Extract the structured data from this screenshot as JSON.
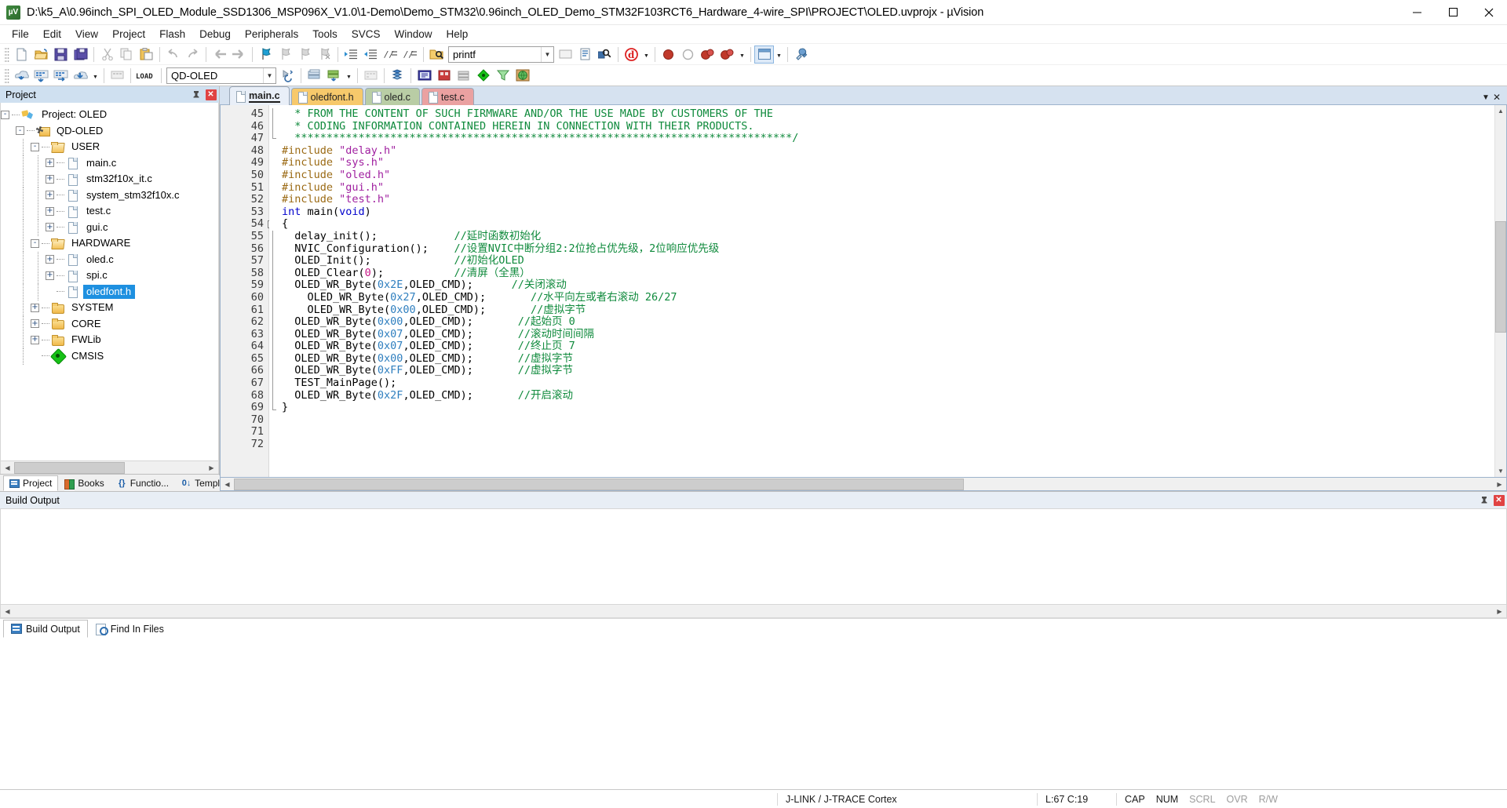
{
  "window": {
    "title": "D:\\k5_A\\0.96inch_SPI_OLED_Module_SSD1306_MSP096X_V1.0\\1-Demo\\Demo_STM32\\0.96inch_OLED_Demo_STM32F103RCT6_Hardware_4-wire_SPI\\PROJECT\\OLED.uvprojx - µVision",
    "logo_text": "µV",
    "minimize": "—",
    "maximize": "❐",
    "close": "✕"
  },
  "menubar": [
    {
      "label": "File"
    },
    {
      "label": "Edit"
    },
    {
      "label": "View"
    },
    {
      "label": "Project"
    },
    {
      "label": "Flash"
    },
    {
      "label": "Debug"
    },
    {
      "label": "Peripherals"
    },
    {
      "label": "Tools"
    },
    {
      "label": "SVCS"
    },
    {
      "label": "Window"
    },
    {
      "label": "Help"
    }
  ],
  "toolbar_main": {
    "buttons": [
      {
        "name": "new-file-icon",
        "glyph": "□"
      },
      {
        "name": "open-file-icon",
        "glyph": "▢"
      },
      {
        "name": "save-icon",
        "glyph": "▣"
      },
      {
        "name": "save-all-icon",
        "glyph": "▤"
      },
      {
        "name": "cut-icon",
        "glyph": "✀"
      },
      {
        "name": "copy-icon",
        "glyph": "⧉"
      },
      {
        "name": "paste-icon",
        "glyph": "▧"
      },
      {
        "name": "undo-icon",
        "glyph": "↶"
      },
      {
        "name": "redo-icon",
        "glyph": "↷"
      },
      {
        "name": "navigate-back-icon",
        "glyph": "←"
      },
      {
        "name": "navigate-forward-icon",
        "glyph": "→"
      },
      {
        "name": "bookmark-toggle-icon",
        "glyph": "⚑"
      },
      {
        "name": "bookmark-prev-icon",
        "glyph": "⚐"
      },
      {
        "name": "bookmark-next-icon",
        "glyph": "⚐"
      },
      {
        "name": "bookmark-clear-icon",
        "glyph": "⚐"
      },
      {
        "name": "indent-icon",
        "glyph": "⇥"
      },
      {
        "name": "outdent-icon",
        "glyph": "⇤"
      },
      {
        "name": "comment-icon",
        "glyph": "//≡"
      },
      {
        "name": "uncomment-icon",
        "glyph": "//≡"
      },
      {
        "name": "find-in-files-icon",
        "glyph": "🔍"
      }
    ],
    "search_value": "printf",
    "right_buttons": [
      {
        "name": "insert-bookmark-icon",
        "glyph": "▭"
      },
      {
        "name": "source-browse-icon",
        "glyph": "▤"
      },
      {
        "name": "find-icon",
        "glyph": "🔍"
      },
      {
        "name": "debug-icon",
        "glyph": "@"
      },
      {
        "name": "breakpoint-icon",
        "glyph": "●"
      },
      {
        "name": "disable-breakpoint-icon",
        "glyph": "○"
      },
      {
        "name": "kill-breakpoints-icon",
        "glyph": "⬣"
      },
      {
        "name": "disable-all-breakpoints-icon",
        "glyph": "⬣"
      },
      {
        "name": "window-layout-icon",
        "glyph": "▥"
      },
      {
        "name": "configure-icon",
        "glyph": "🔧"
      }
    ]
  },
  "toolbar_build": {
    "buttons": [
      {
        "name": "translate-icon",
        "glyph": "⬇"
      },
      {
        "name": "build-icon",
        "glyph": "▦"
      },
      {
        "name": "rebuild-icon",
        "glyph": "▦"
      },
      {
        "name": "batch-build-icon",
        "glyph": "⬇"
      },
      {
        "name": "stop-build-icon",
        "glyph": "▨"
      },
      {
        "name": "download-icon",
        "glyph": "LOAD"
      },
      {
        "name": "target-options-icon",
        "glyph": "✦"
      },
      {
        "name": "manage-project-items-icon",
        "glyph": "▩"
      },
      {
        "name": "packs-icon",
        "glyph": "◆"
      },
      {
        "name": "pack-installer-icon",
        "glyph": "▽"
      },
      {
        "name": "manage-run-time-env-icon",
        "glyph": "▦"
      }
    ],
    "target_value": "QD-OLED"
  },
  "project_panel": {
    "header": "Project",
    "pin_glyph": "📌",
    "close_glyph": "✕",
    "tree": [
      {
        "label": "Project: OLED",
        "depth": 0,
        "icon": "proj",
        "expander": "-",
        "selected": false
      },
      {
        "label": "QD-OLED",
        "depth": 1,
        "icon": "target",
        "expander": "-",
        "selected": false
      },
      {
        "label": "USER",
        "depth": 2,
        "icon": "folder-open",
        "expander": "-",
        "selected": false
      },
      {
        "label": "main.c",
        "depth": 3,
        "icon": "file",
        "expander": "+",
        "selected": false
      },
      {
        "label": "stm32f10x_it.c",
        "depth": 3,
        "icon": "file",
        "expander": "+",
        "selected": false
      },
      {
        "label": "system_stm32f10x.c",
        "depth": 3,
        "icon": "file",
        "expander": "+",
        "selected": false
      },
      {
        "label": "test.c",
        "depth": 3,
        "icon": "file",
        "expander": "+",
        "selected": false
      },
      {
        "label": "gui.c",
        "depth": 3,
        "icon": "file",
        "expander": "+",
        "selected": false
      },
      {
        "label": "HARDWARE",
        "depth": 2,
        "icon": "folder-open",
        "expander": "-",
        "selected": false
      },
      {
        "label": "oled.c",
        "depth": 3,
        "icon": "file",
        "expander": "+",
        "selected": false
      },
      {
        "label": "spi.c",
        "depth": 3,
        "icon": "file",
        "expander": "+",
        "selected": false
      },
      {
        "label": "oledfont.h",
        "depth": 3,
        "icon": "file",
        "expander": "",
        "selected": true
      },
      {
        "label": "SYSTEM",
        "depth": 2,
        "icon": "folder",
        "expander": "+",
        "selected": false
      },
      {
        "label": "CORE",
        "depth": 2,
        "icon": "folder",
        "expander": "+",
        "selected": false
      },
      {
        "label": "FWLib",
        "depth": 2,
        "icon": "folder",
        "expander": "+",
        "selected": false
      },
      {
        "label": "CMSIS",
        "depth": 2,
        "icon": "cmsis",
        "expander": "",
        "selected": false
      }
    ],
    "tabs": [
      {
        "label": "Project",
        "icon": "pi-project",
        "active": true
      },
      {
        "label": "Books",
        "icon": "pi-books",
        "active": false
      },
      {
        "label": "Functio...",
        "icon": "pi-funcs",
        "glyph": "{}",
        "active": false
      },
      {
        "label": "Templa...",
        "icon": "pi-templ",
        "glyph": "0↓",
        "active": false
      }
    ]
  },
  "editor": {
    "tabs": [
      {
        "label": "main.c",
        "style": "active",
        "active": true
      },
      {
        "label": "oledfont.h",
        "style": "t-yellow",
        "active": false
      },
      {
        "label": "oled.c",
        "style": "t-green",
        "active": false
      },
      {
        "label": "test.c",
        "style": "t-red",
        "active": false
      }
    ],
    "collapse_glyph": "▼",
    "close_glyph": "✕",
    "first_line_number": 45,
    "lines": [
      {
        "n": 45,
        "fold": "",
        "segs": [
          {
            "t": "  * FROM THE CONTENT OF SUCH FIRMWARE AND/OR THE USE MADE BY CUSTOMERS OF THE",
            "c": "c-cmt"
          }
        ]
      },
      {
        "n": 46,
        "fold": "",
        "segs": [
          {
            "t": "  * CODING INFORMATION CONTAINED HEREIN IN CONNECTION WITH THEIR PRODUCTS.",
            "c": "c-cmt"
          }
        ]
      },
      {
        "n": 47,
        "fold": "",
        "segs": [
          {
            "t": "  ******************************************************************************/",
            "c": "c-cmt"
          }
        ]
      },
      {
        "n": 48,
        "fold": "",
        "segs": [
          {
            "t": "#include ",
            "c": "c-pre"
          },
          {
            "t": "\"delay.h\"",
            "c": "c-str"
          }
        ]
      },
      {
        "n": 49,
        "fold": "",
        "segs": [
          {
            "t": "#include ",
            "c": "c-pre"
          },
          {
            "t": "\"sys.h\"",
            "c": "c-str"
          }
        ]
      },
      {
        "n": 50,
        "fold": "",
        "segs": [
          {
            "t": "#include ",
            "c": "c-pre"
          },
          {
            "t": "\"oled.h\"",
            "c": "c-str"
          }
        ]
      },
      {
        "n": 51,
        "fold": "",
        "segs": [
          {
            "t": "#include ",
            "c": "c-pre"
          },
          {
            "t": "\"gui.h\"",
            "c": "c-str"
          }
        ]
      },
      {
        "n": 52,
        "fold": "",
        "segs": [
          {
            "t": "#include ",
            "c": "c-pre"
          },
          {
            "t": "\"test.h\"",
            "c": "c-str"
          }
        ]
      },
      {
        "n": 53,
        "fold": "",
        "segs": [
          {
            "t": "int ",
            "c": "c-kw"
          },
          {
            "t": "main(",
            "c": "c-plain"
          },
          {
            "t": "void",
            "c": "c-kw"
          },
          {
            "t": ")",
            "c": "c-plain"
          }
        ]
      },
      {
        "n": 54,
        "fold": "-",
        "segs": [
          {
            "t": "{",
            "c": "c-plain"
          }
        ]
      },
      {
        "n": 55,
        "fold": "",
        "segs": [
          {
            "t": "  delay_init();            ",
            "c": "c-plain"
          },
          {
            "t": "//延时函数初始化",
            "c": "c-cmt"
          }
        ]
      },
      {
        "n": 56,
        "fold": "",
        "segs": [
          {
            "t": "  NVIC_Configuration();    ",
            "c": "c-plain"
          },
          {
            "t": "//设置NVIC中断分组2:2位抢占优先级，2位响应优先级",
            "c": "c-cmt"
          }
        ]
      },
      {
        "n": 57,
        "fold": "",
        "segs": [
          {
            "t": "  OLED_Init();             ",
            "c": "c-plain"
          },
          {
            "t": "//初始化OLED",
            "c": "c-cmt"
          }
        ]
      },
      {
        "n": 58,
        "fold": "",
        "segs": [
          {
            "t": "  OLED_Clear(",
            "c": "c-plain"
          },
          {
            "t": "0",
            "c": "c-num"
          },
          {
            "t": ");           ",
            "c": "c-plain"
          },
          {
            "t": "//清屏（全黑）",
            "c": "c-cmt"
          }
        ]
      },
      {
        "n": 59,
        "fold": "",
        "segs": [
          {
            "t": "  OLED_WR_Byte(",
            "c": "c-plain"
          },
          {
            "t": "0x2E",
            "c": "c-num2"
          },
          {
            "t": ",OLED_CMD);      ",
            "c": "c-plain"
          },
          {
            "t": "//关闭滚动",
            "c": "c-cmt"
          }
        ]
      },
      {
        "n": 60,
        "fold": "",
        "segs": [
          {
            "t": "    OLED_WR_Byte(",
            "c": "c-plain"
          },
          {
            "t": "0x27",
            "c": "c-num2"
          },
          {
            "t": ",OLED_CMD);       ",
            "c": "c-plain"
          },
          {
            "t": "//水平向左或者右滚动 26/27",
            "c": "c-cmt"
          }
        ]
      },
      {
        "n": 61,
        "fold": "",
        "segs": [
          {
            "t": "    OLED_WR_Byte(",
            "c": "c-plain"
          },
          {
            "t": "0x00",
            "c": "c-num2"
          },
          {
            "t": ",OLED_CMD);       ",
            "c": "c-plain"
          },
          {
            "t": "//虚拟字节",
            "c": "c-cmt"
          }
        ]
      },
      {
        "n": 62,
        "fold": "",
        "segs": [
          {
            "t": "  OLED_WR_Byte(",
            "c": "c-plain"
          },
          {
            "t": "0x00",
            "c": "c-num2"
          },
          {
            "t": ",OLED_CMD);       ",
            "c": "c-plain"
          },
          {
            "t": "//起始页 0",
            "c": "c-cmt"
          }
        ]
      },
      {
        "n": 63,
        "fold": "",
        "segs": [
          {
            "t": "  OLED_WR_Byte(",
            "c": "c-plain"
          },
          {
            "t": "0x07",
            "c": "c-num2"
          },
          {
            "t": ",OLED_CMD);       ",
            "c": "c-plain"
          },
          {
            "t": "//滚动时间间隔",
            "c": "c-cmt"
          }
        ]
      },
      {
        "n": 64,
        "fold": "",
        "segs": [
          {
            "t": "  OLED_WR_Byte(",
            "c": "c-plain"
          },
          {
            "t": "0x07",
            "c": "c-num2"
          },
          {
            "t": ",OLED_CMD);       ",
            "c": "c-plain"
          },
          {
            "t": "//终止页 7",
            "c": "c-cmt"
          }
        ]
      },
      {
        "n": 65,
        "fold": "",
        "segs": [
          {
            "t": "  OLED_WR_Byte(",
            "c": "c-plain"
          },
          {
            "t": "0x00",
            "c": "c-num2"
          },
          {
            "t": ",OLED_CMD);       ",
            "c": "c-plain"
          },
          {
            "t": "//虚拟字节",
            "c": "c-cmt"
          }
        ]
      },
      {
        "n": 66,
        "fold": "",
        "segs": [
          {
            "t": "  OLED_WR_Byte(",
            "c": "c-plain"
          },
          {
            "t": "0xFF",
            "c": "c-num2"
          },
          {
            "t": ",OLED_CMD);       ",
            "c": "c-plain"
          },
          {
            "t": "//虚拟字节",
            "c": "c-cmt"
          }
        ]
      },
      {
        "n": 67,
        "fold": "",
        "segs": [
          {
            "t": "  TEST_MainPage();",
            "c": "c-plain"
          }
        ]
      },
      {
        "n": 68,
        "fold": "",
        "segs": [
          {
            "t": "  OLED_WR_Byte(",
            "c": "c-plain"
          },
          {
            "t": "0x2F",
            "c": "c-num2"
          },
          {
            "t": ",OLED_CMD);       ",
            "c": "c-plain"
          },
          {
            "t": "//开启滚动",
            "c": "c-cmt"
          }
        ]
      },
      {
        "n": 69,
        "fold": "",
        "segs": [
          {
            "t": "}",
            "c": "c-plain"
          }
        ]
      },
      {
        "n": 70,
        "fold": "",
        "segs": [
          {
            "t": "",
            "c": "c-plain"
          }
        ]
      },
      {
        "n": 71,
        "fold": "",
        "segs": [
          {
            "t": "",
            "c": "c-plain"
          }
        ]
      },
      {
        "n": 72,
        "fold": "",
        "segs": [
          {
            "t": "",
            "c": "c-plain"
          }
        ]
      }
    ]
  },
  "build_output": {
    "header": "Build Output",
    "pin_glyph": "📌",
    "close_glyph": "✕",
    "content": ""
  },
  "bottom_tabs": [
    {
      "label": "Build Output",
      "icon": "bi-build",
      "active": true
    },
    {
      "label": "Find In Files",
      "icon": "bi-find",
      "active": false
    }
  ],
  "statusbar": {
    "message": "",
    "debugger": "J-LINK / J-TRACE Cortex",
    "position": "L:67 C:19",
    "flags": [
      {
        "label": "CAP",
        "dim": false
      },
      {
        "label": "NUM",
        "dim": false
      },
      {
        "label": "SCRL",
        "dim": true
      },
      {
        "label": "OVR",
        "dim": true
      },
      {
        "label": "R/W",
        "dim": true
      }
    ]
  },
  "colors": {
    "titlebar_bg": "#ffffff",
    "panel_header": "#cfe0f0",
    "tabstrip_bg": "#d6e2f0",
    "selection": "#1e90e0",
    "comment_green": "#0f8a3c",
    "string_purple": "#a020a0",
    "keyword_blue": "#0000cc",
    "preproc_olive": "#9b6a14",
    "tab_yellow": "#f7c96b",
    "tab_green": "#b9cda5",
    "tab_red": "#eaa1a1"
  }
}
